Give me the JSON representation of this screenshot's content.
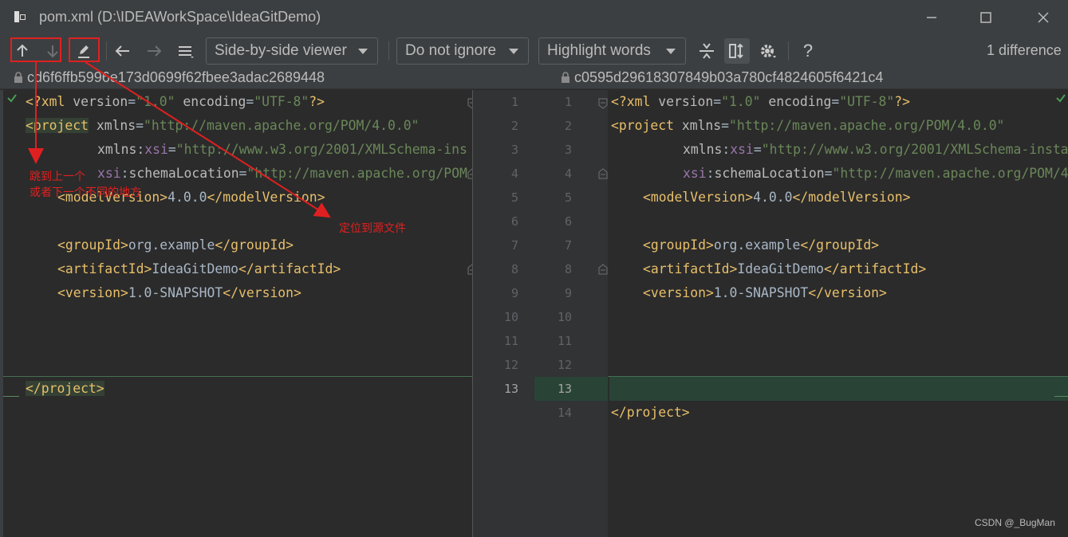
{
  "window": {
    "title": "pom.xml (D:\\IDEAWorkSpace\\IdeaGitDemo)"
  },
  "toolbar": {
    "viewer_dropdown": "Side-by-side viewer",
    "ignore_dropdown": "Do not ignore",
    "highlight_dropdown": "Highlight words",
    "help_label": "?",
    "difference_count": "1 difference"
  },
  "revisions": {
    "left_hash": "cd6f6ffb5996e173d0699f62fbee3adac2689448",
    "right_hash": "c0595d29618307849b03a780cf4824605f6421c4"
  },
  "left_line_numbers": [
    "1",
    "2",
    "3",
    "4",
    "5",
    "6",
    "7",
    "8",
    "9",
    "10",
    "11",
    "12",
    "13"
  ],
  "right_line_numbers": [
    "1",
    "2",
    "3",
    "4",
    "5",
    "6",
    "7",
    "8",
    "9",
    "10",
    "11",
    "12",
    "13",
    "14"
  ],
  "code": {
    "xml_decl_start": "<?xml ",
    "version_attr": "version",
    "version_val": "\"1.0\"",
    "encoding_attr": "encoding",
    "encoding_val": "\"UTF-8\"",
    "xml_decl_end": "?>",
    "project_open": "<project",
    "xmlns_attr": "xmlns",
    "xmlns_val": "\"http://maven.apache.org/POM/4.0.0\"",
    "xmlns_prefix": "xmlns",
    "xsi": "xsi",
    "xsi_left_val": "\"http://www.w3.org/2001/XMLSchema-ins",
    "xsi_right_val": "\"http://www.w3.org/2001/XMLSchema-insta",
    "schema_attr": "schemaLocation",
    "schema_left_val": "\"http://maven.apache.org/POM",
    "schema_right_val": "\"http://maven.apache.org/POM/4",
    "model_open": "<modelVersion>",
    "model_val": "4.0.0",
    "model_close": "</modelVersion>",
    "group_open": "<groupId>",
    "group_val": "org.example",
    "group_close": "</groupId>",
    "artifact_open": "<artifactId>",
    "artifact_val": "IdeaGitDemo",
    "artifact_close": "</artifactId>",
    "version_open": "<version>",
    "version_val_text": "1.0-SNAPSHOT",
    "version_close": "</version>",
    "project_close": "</project>",
    "eq": "=",
    "colon": ":"
  },
  "annotations": {
    "jump_line1": "跳到上一个",
    "jump_line2": "或者下一个不同的地方",
    "locate_source": "定位到源文件",
    "annotation_color": "#e02020"
  },
  "watermark": "CSDN @_BugMan",
  "colors": {
    "tag": "#e8bf6a",
    "string": "#6a8759",
    "namespace": "#9876aa",
    "added_bg": "#294436"
  }
}
